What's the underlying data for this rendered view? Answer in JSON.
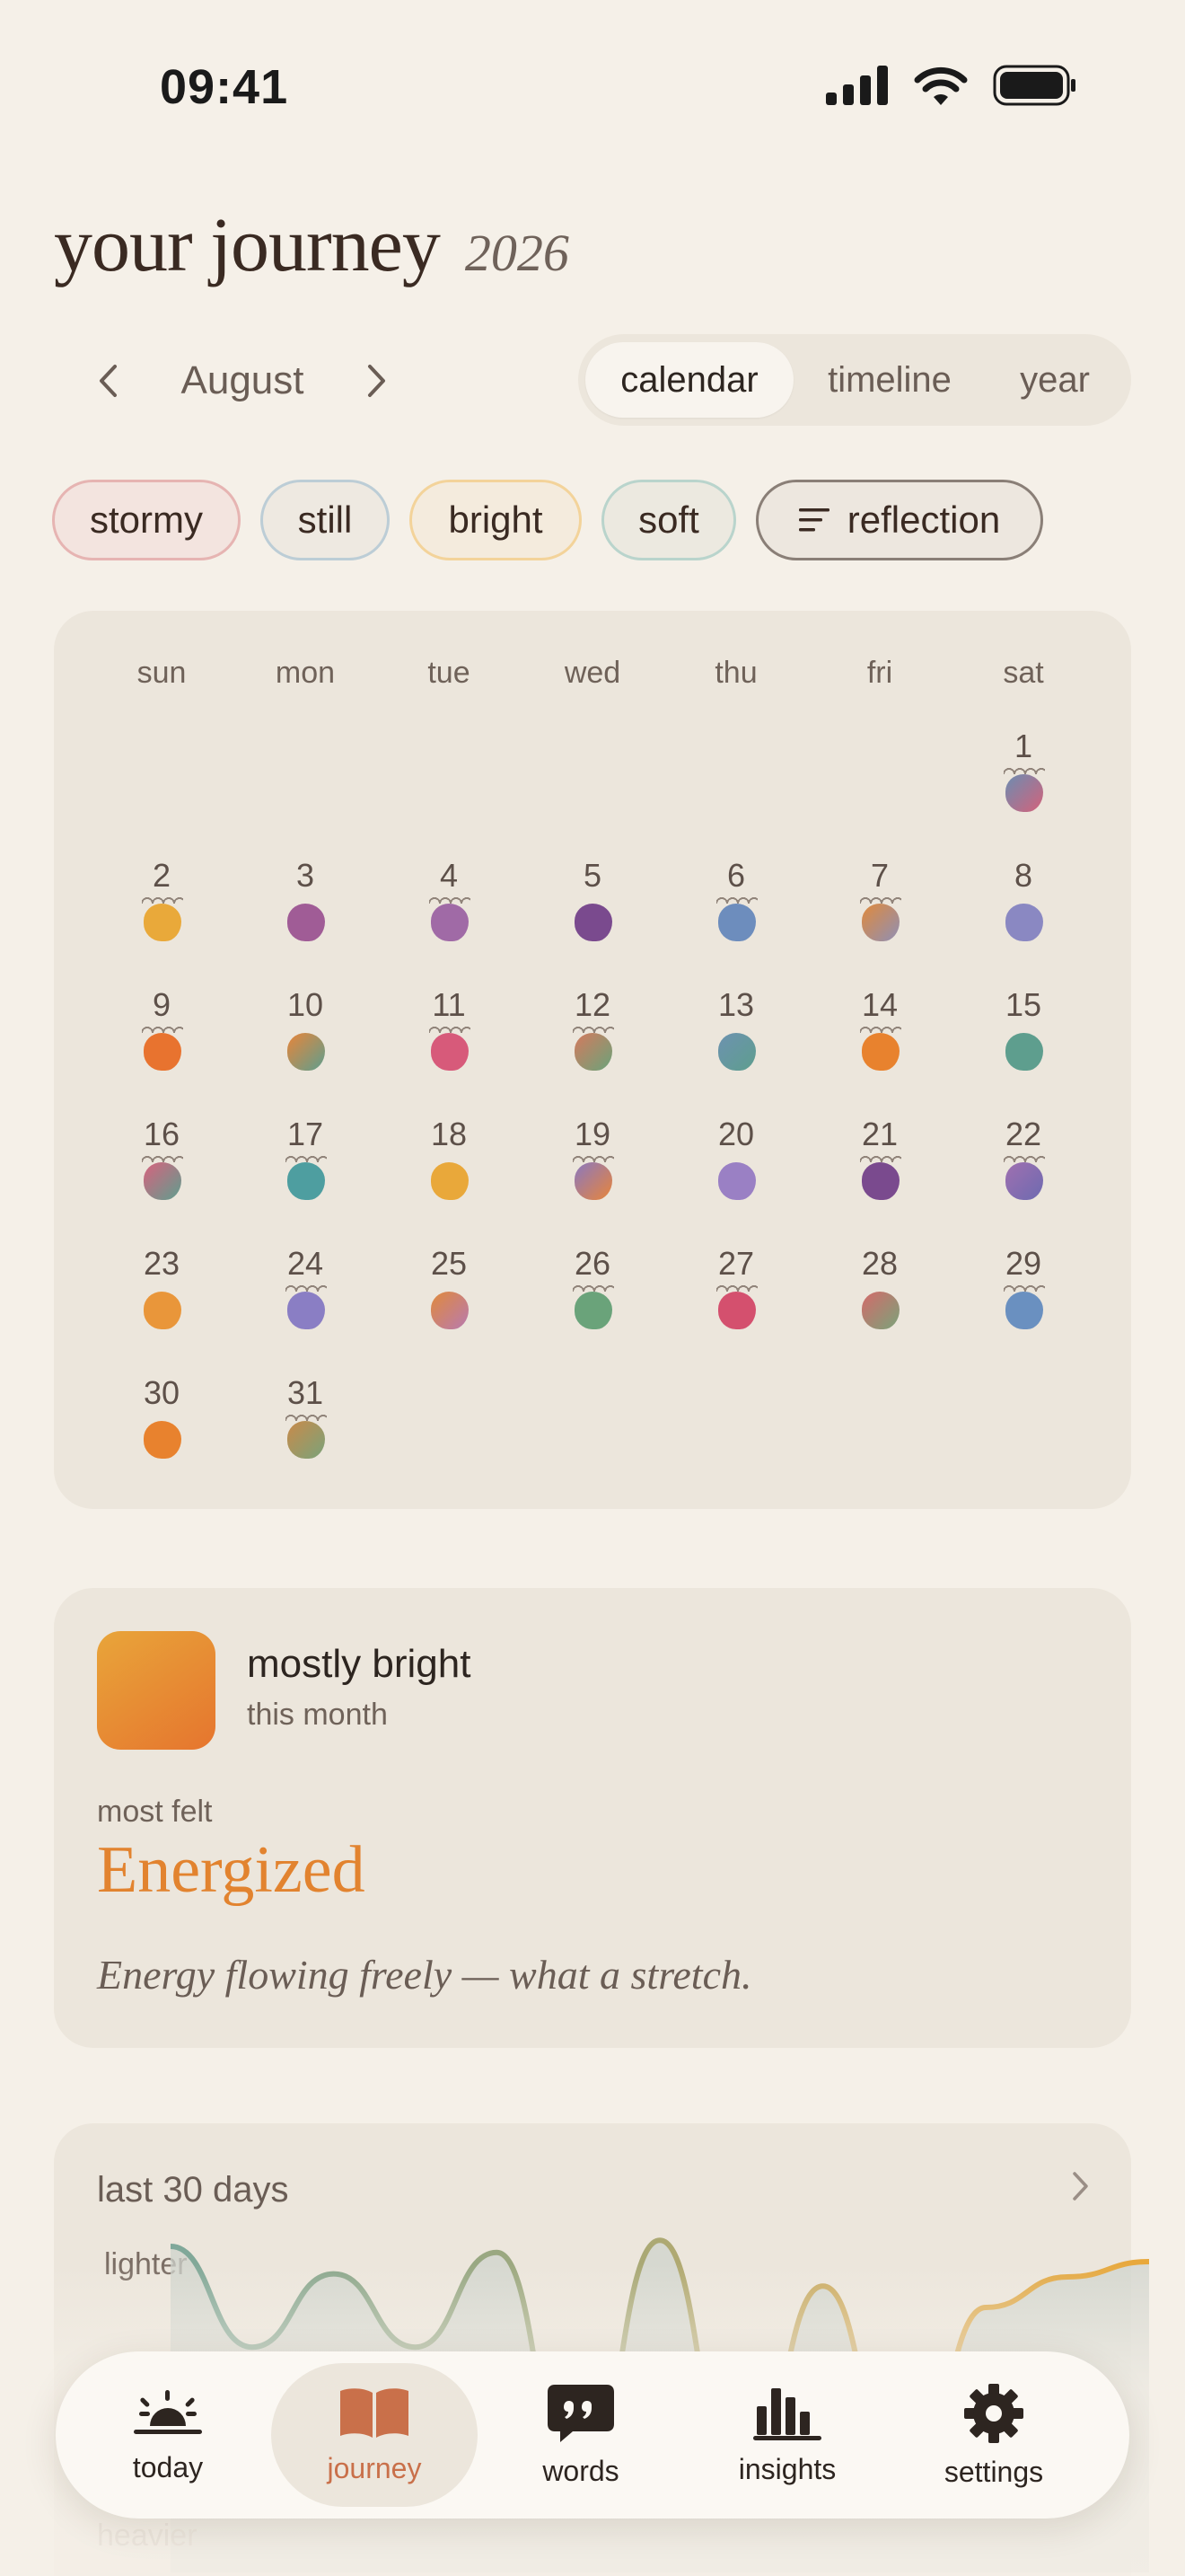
{
  "status_bar": {
    "time": "09:41"
  },
  "header": {
    "title": "your journey",
    "year": "2026"
  },
  "month_nav": {
    "month": "August"
  },
  "view_tabs": [
    {
      "label": "calendar",
      "active": true
    },
    {
      "label": "timeline",
      "active": false
    },
    {
      "label": "year",
      "active": false
    }
  ],
  "filters": [
    {
      "label": "stormy",
      "border": "#e6b4b2",
      "bg": "#f3e4df"
    },
    {
      "label": "still",
      "border": "#bccdd6",
      "bg": "#eee9e1"
    },
    {
      "label": "bright",
      "border": "#f3d39a",
      "bg": "#f4ebdd"
    },
    {
      "label": "soft",
      "border": "#b9d4cc",
      "bg": "#ece9e0"
    },
    {
      "label": "reflection",
      "border": "#8a7f77",
      "bg": "#ede7df",
      "icon": "lines-icon"
    }
  ],
  "calendar": {
    "weekdays": [
      "sun",
      "mon",
      "tue",
      "wed",
      "thu",
      "fri",
      "sat"
    ],
    "first_weekday_index": 6,
    "days": [
      {
        "n": "1",
        "c1": "#6b8db2",
        "c2": "#d4627a",
        "wavy": true
      },
      {
        "n": "2",
        "c1": "#e9a93a",
        "c2": "#e9a93a",
        "wavy": true
      },
      {
        "n": "3",
        "c1": "#a05c96",
        "c2": "#a05c96",
        "wavy": false
      },
      {
        "n": "4",
        "c1": "#a06aa6",
        "c2": "#a06aa6",
        "wavy": true
      },
      {
        "n": "5",
        "c1": "#7a4a8e",
        "c2": "#7a4a8e",
        "wavy": false
      },
      {
        "n": "6",
        "c1": "#6d8dbd",
        "c2": "#6d8dbd",
        "wavy": true
      },
      {
        "n": "7",
        "c1": "#e08a3c",
        "c2": "#8f8fb5",
        "wavy": true
      },
      {
        "n": "8",
        "c1": "#8a88c2",
        "c2": "#8a88c2",
        "wavy": false
      },
      {
        "n": "9",
        "c1": "#e8732f",
        "c2": "#e8732f",
        "wavy": true
      },
      {
        "n": "10",
        "c1": "#e8853a",
        "c2": "#5e9e8e",
        "wavy": false
      },
      {
        "n": "11",
        "c1": "#d75a7a",
        "c2": "#d75a7a",
        "wavy": true
      },
      {
        "n": "12",
        "c1": "#d47a5e",
        "c2": "#6aa37a",
        "wavy": true
      },
      {
        "n": "13",
        "c1": "#6d92b0",
        "c2": "#5e9e8e",
        "wavy": false
      },
      {
        "n": "14",
        "c1": "#e8822e",
        "c2": "#e8822e",
        "wavy": true
      },
      {
        "n": "15",
        "c1": "#5e9e8e",
        "c2": "#5e9e8e",
        "wavy": false
      },
      {
        "n": "16",
        "c1": "#d8627e",
        "c2": "#5e9e8e",
        "wavy": true
      },
      {
        "n": "17",
        "c1": "#4e9ea0",
        "c2": "#4e9ea0",
        "wavy": true
      },
      {
        "n": "18",
        "c1": "#e9a83a",
        "c2": "#e9a83a",
        "wavy": false
      },
      {
        "n": "19",
        "c1": "#8a78c0",
        "c2": "#e8853a",
        "wavy": true
      },
      {
        "n": "20",
        "c1": "#9a80c4",
        "c2": "#9a80c4",
        "wavy": false
      },
      {
        "n": "21",
        "c1": "#7a4a8e",
        "c2": "#7a4a8e",
        "wavy": true
      },
      {
        "n": "22",
        "c1": "#a070b0",
        "c2": "#6d6ab0",
        "wavy": true
      },
      {
        "n": "23",
        "c1": "#e9963a",
        "c2": "#e9963a",
        "wavy": false
      },
      {
        "n": "24",
        "c1": "#8a7ec4",
        "c2": "#8a7ec4",
        "wavy": true
      },
      {
        "n": "25",
        "c1": "#e08a3c",
        "c2": "#b87ab0",
        "wavy": false
      },
      {
        "n": "26",
        "c1": "#6aa37a",
        "c2": "#6aa37a",
        "wavy": true
      },
      {
        "n": "27",
        "c1": "#d4506e",
        "c2": "#d4506e",
        "wavy": true
      },
      {
        "n": "28",
        "c1": "#d46a6a",
        "c2": "#7aa37a",
        "wavy": false
      },
      {
        "n": "29",
        "c1": "#6a90c0",
        "c2": "#6a90c0",
        "wavy": true
      },
      {
        "n": "30",
        "c1": "#e8822e",
        "c2": "#e8822e",
        "wavy": false
      },
      {
        "n": "31",
        "c1": "#c98a4a",
        "c2": "#7aa37a",
        "wavy": true
      }
    ]
  },
  "summary": {
    "title": "mostly bright",
    "subtitle": "this month",
    "most_felt_label": "most felt",
    "most_felt_value": "Energized",
    "quote": "Energy flowing freely — what a stretch."
  },
  "trend": {
    "title": "last 30 days",
    "label_top": "lighter",
    "label_bottom": "heavier",
    "values": [
      0.95,
      0.62,
      0.86,
      0.62,
      0.93,
      0.1,
      0.97,
      0.1,
      0.82,
      0.1,
      0.75,
      0.85,
      0.9
    ]
  },
  "bottom_nav": [
    {
      "label": "today",
      "icon": "sunrise-icon",
      "active": false
    },
    {
      "label": "journey",
      "icon": "book-icon",
      "active": true
    },
    {
      "label": "words",
      "icon": "quote-bubble-icon",
      "active": false
    },
    {
      "label": "insights",
      "icon": "bar-chart-icon",
      "active": false
    },
    {
      "label": "settings",
      "icon": "gear-icon",
      "active": false
    }
  ],
  "colors": {
    "accent": "#e2832f",
    "active_nav": "#c9704a",
    "background": "#f5f0e8",
    "card": "#ece6dc"
  }
}
